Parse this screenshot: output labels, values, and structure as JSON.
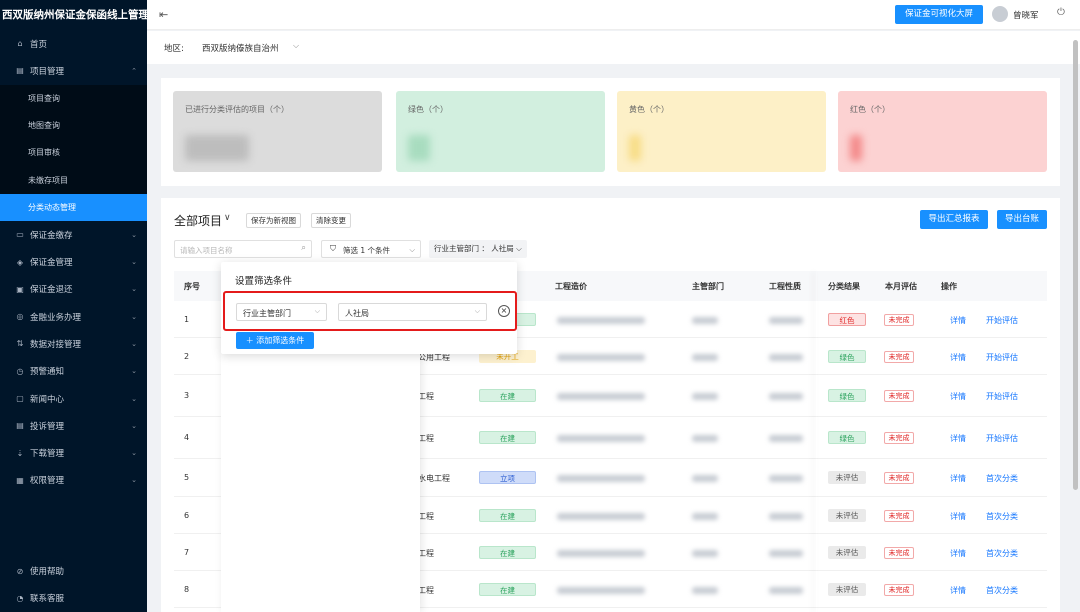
{
  "app": {
    "title": "西双版纳州保证金保函线上管理平台"
  },
  "sidebar": {
    "items": [
      {
        "label": "首页",
        "icon": "home-icon",
        "glyph": "⌂",
        "expandable": false
      },
      {
        "label": "项目管理",
        "icon": "project-icon",
        "glyph": "▤",
        "expandable": true,
        "expanded": true
      }
    ],
    "subitems": [
      {
        "label": "项目查询",
        "active": false
      },
      {
        "label": "地图查询",
        "active": false
      },
      {
        "label": "项目审核",
        "active": false
      },
      {
        "label": "未缴存项目",
        "active": false
      },
      {
        "label": "分类动态管理",
        "active": true
      }
    ],
    "more_items": [
      {
        "label": "保证金缴存",
        "icon": "deposit-icon",
        "glyph": "▭"
      },
      {
        "label": "保证金管理",
        "icon": "shield-icon",
        "glyph": "◈"
      },
      {
        "label": "保证金退还",
        "icon": "refund-icon",
        "glyph": "▣"
      },
      {
        "label": "金融业务办理",
        "icon": "finance-icon",
        "glyph": "◎"
      },
      {
        "label": "数据对接管理",
        "icon": "data-icon",
        "glyph": "⇅"
      },
      {
        "label": "预警通知",
        "icon": "warning-icon",
        "glyph": "◷"
      },
      {
        "label": "新闻中心",
        "icon": "news-icon",
        "glyph": "▢"
      },
      {
        "label": "投诉管理",
        "icon": "complaint-icon",
        "glyph": "▤"
      },
      {
        "label": "下载管理",
        "icon": "download-icon",
        "glyph": "⇣"
      },
      {
        "label": "权限管理",
        "icon": "lock-icon",
        "glyph": "▦"
      }
    ],
    "bottom": [
      {
        "label": "使用帮助",
        "icon": "help-icon",
        "glyph": "⊘"
      },
      {
        "label": "联系客服",
        "icon": "service-icon",
        "glyph": "◔"
      }
    ]
  },
  "header": {
    "visual_button": "保证金可视化大屏",
    "user_name": "曾晓军"
  },
  "region": {
    "label": "地区:",
    "value": "西双版纳傣族自治州"
  },
  "stats": [
    {
      "title": "已进行分类评估的项目（个）",
      "value": "████"
    },
    {
      "title": "绿色（个）",
      "value": "██"
    },
    {
      "title": "黄色（个）",
      "value": "█"
    },
    {
      "title": "红色（个）",
      "value": "█"
    }
  ],
  "list": {
    "title": "全部项目",
    "save_view": "保存为新视图",
    "clear_changes": "清除变更",
    "export_summary": "导出汇总报表",
    "export_ledger": "导出台账",
    "search_placeholder": "请输入项目名称",
    "filter_label": "筛选",
    "filter_count": "1 个条件",
    "active_filter_chip": "行业主管部门 ： 人社局"
  },
  "table": {
    "columns": [
      "序号",
      "工程造价",
      "主管部门",
      "工程性质",
      "分类结果",
      "本月评估",
      "操作"
    ],
    "rows": [
      {
        "no": "1",
        "type": "",
        "status": "",
        "status_style": "green",
        "result": "红色",
        "result_style": "red",
        "eval": "未完成",
        "action": "开始评估"
      },
      {
        "no": "2",
        "type": "公用工程",
        "status": "未开工",
        "status_style": "yellow",
        "result": "绿色",
        "result_style": "green",
        "eval": "未完成",
        "action": "开始评估"
      },
      {
        "no": "3",
        "type": "工程",
        "status": "在建",
        "status_style": "green",
        "result": "绿色",
        "result_style": "green",
        "eval": "未完成",
        "action": "开始评估"
      },
      {
        "no": "4",
        "type": "工程",
        "status": "在建",
        "status_style": "green",
        "result": "绿色",
        "result_style": "green",
        "eval": "未完成",
        "action": "开始评估"
      },
      {
        "no": "5",
        "type": "水电工程",
        "status": "立项",
        "status_style": "blue",
        "result": "未评估",
        "result_style": "gray",
        "eval": "未完成",
        "action": "首次分类"
      },
      {
        "no": "6",
        "type": "工程",
        "status": "在建",
        "status_style": "green",
        "result": "未评估",
        "result_style": "gray",
        "eval": "未完成",
        "action": "首次分类"
      },
      {
        "no": "7",
        "type": "工程",
        "status": "在建",
        "status_style": "green",
        "result": "未评估",
        "result_style": "gray",
        "eval": "未完成",
        "action": "首次分类"
      },
      {
        "no": "8",
        "type": "工程",
        "status": "在建",
        "status_style": "green",
        "result": "未评估",
        "result_style": "gray",
        "eval": "未完成",
        "action": "首次分类"
      }
    ],
    "detail_link": "详情"
  },
  "filter_popover": {
    "title": "设置筛选条件",
    "field": "行业主管部门",
    "value": "人社局",
    "add_button": "添加筛选条件"
  }
}
